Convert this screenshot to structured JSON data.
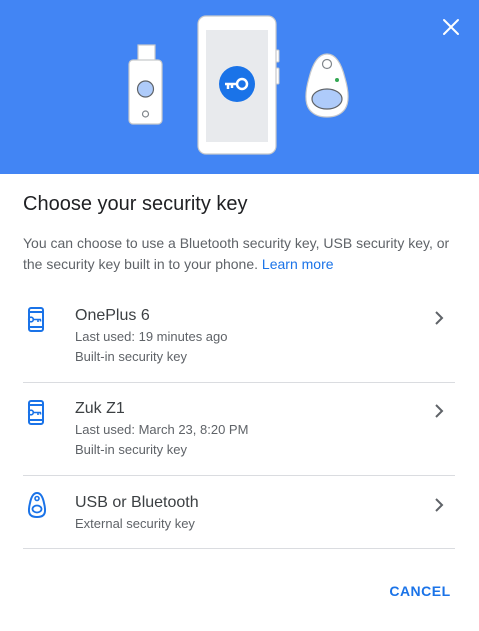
{
  "dialog": {
    "title": "Choose your security key",
    "description": "You can choose to use a Bluetooth security key, USB security key, or the security key built in to your phone.",
    "learn_more": "Learn more",
    "cancel_label": "CANCEL",
    "close_icon": "close-icon"
  },
  "colors": {
    "hero_background": "#4285f4",
    "accent": "#1a73e8",
    "title_text": "#202124",
    "secondary_text": "#5f6368",
    "divider": "#dadce0"
  },
  "options": [
    {
      "name": "OnePlus 6",
      "last_used": "Last used: 19 minutes ago",
      "type": "Built-in security key",
      "icon": "phone-key-icon"
    },
    {
      "name": "Zuk Z1",
      "last_used": "Last used: March 23, 8:20 PM",
      "type": "Built-in security key",
      "icon": "phone-key-icon"
    },
    {
      "name": "USB or Bluetooth",
      "type": "External security key",
      "icon": "security-key-fob-icon"
    }
  ]
}
